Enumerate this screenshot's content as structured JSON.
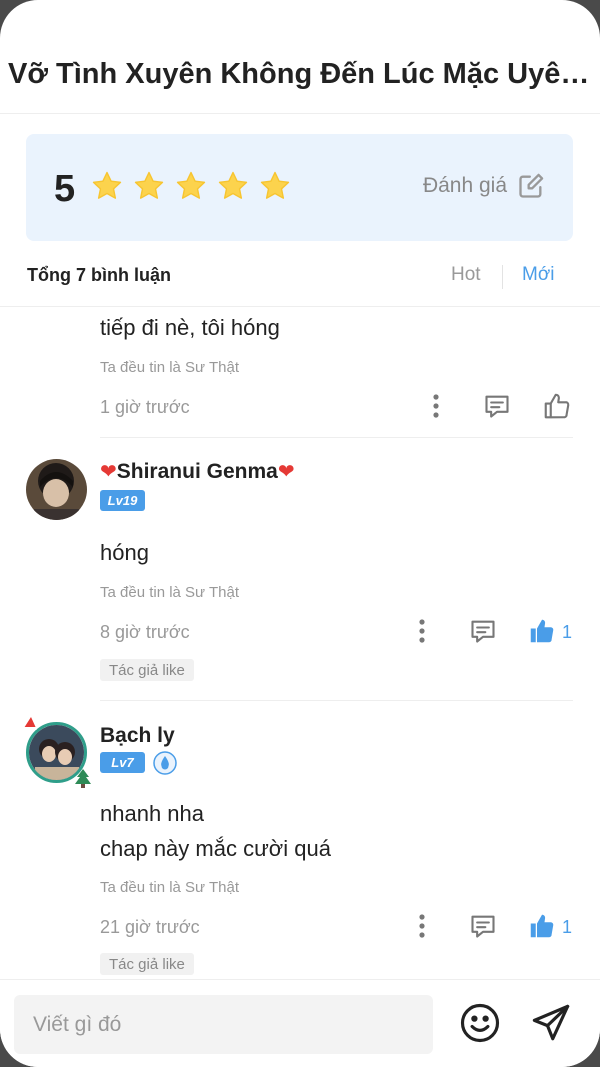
{
  "header": {
    "title": "Vỡ Tình Xuyên Không Đến Lúc Mặc Uyên C..."
  },
  "rating": {
    "score": "5",
    "stars_filled": 5,
    "stars_total": 5,
    "rate_label": "Đánh giá",
    "star_color": "#fcd34d"
  },
  "summary": {
    "total": "Tổng 7 bình luận",
    "sort_hot": "Hot",
    "sort_new": "Mới",
    "active_sort": "Mới"
  },
  "comments": [
    {
      "text": "tiếp đi nè, tôi hóng",
      "subtitle": "Ta đều tin là Sư Thật",
      "time": "1 giờ trước"
    },
    {
      "username": "Shiranui Genma",
      "level": "Lv19",
      "text": "hóng",
      "subtitle": "Ta đều tin là Sư Thật",
      "time": "8 giờ trước",
      "likes": "1",
      "author_tag": "Tác giả like"
    },
    {
      "username": "Bạch ly",
      "level": "Lv7",
      "text_line1": "nhanh nha",
      "text_line2": "chap này mắc cười quá",
      "subtitle": "Ta đều tin là Sư Thật",
      "time": "21 giờ trước",
      "likes": "1",
      "author_tag": "Tác giả like"
    }
  ],
  "composer": {
    "placeholder": "Viết gì đó"
  },
  "colors": {
    "accent": "#4a9de8",
    "rating_bg": "#eaf3fd",
    "star": "#fcd34d"
  }
}
